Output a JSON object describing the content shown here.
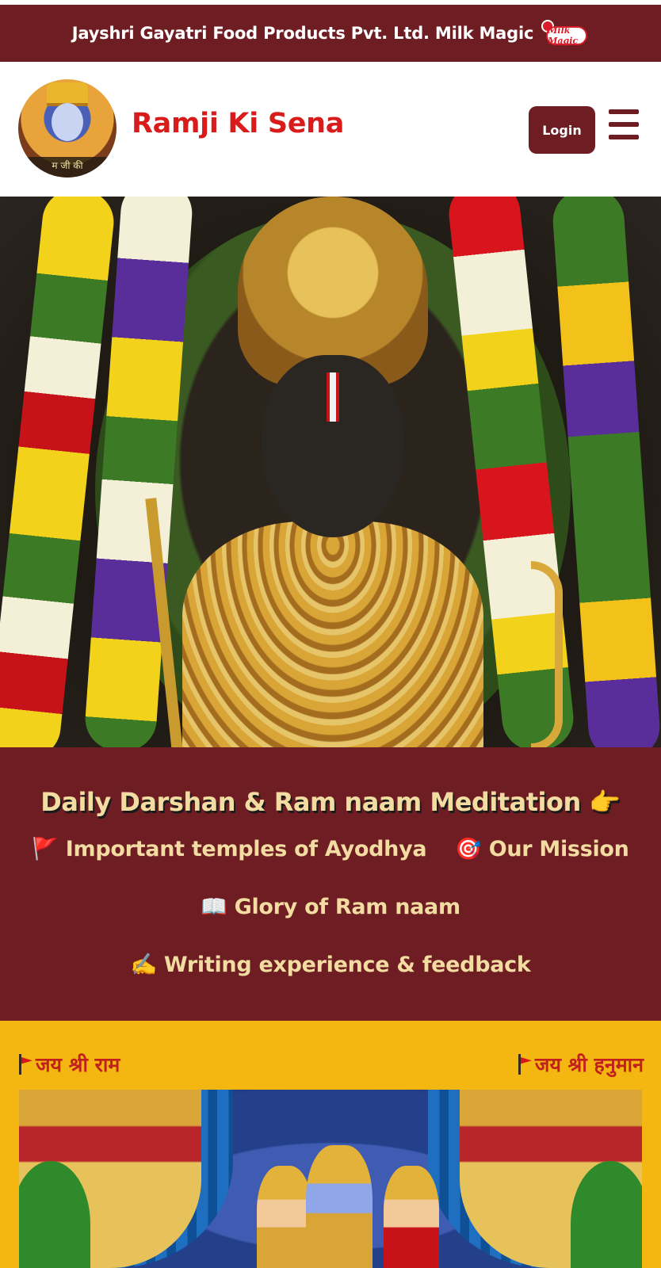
{
  "announcement": {
    "text": "Jayshri Gayatri Food Products Pvt. Ltd. Milk Magic",
    "brand_badge": "Milk Magic",
    "background_color": "#6e1e22"
  },
  "header": {
    "logo_caption": "म जी की",
    "site_title": "Ramji Ki Sena",
    "title_color": "#d81c1c",
    "login_label": "Login",
    "menu_icon": "hamburger-menu-icon"
  },
  "hero": {
    "image": "ram-lalla-idol-with-flower-garlands"
  },
  "links_panel": {
    "meditation": "Daily Darshan & Ram naam Meditation 👉",
    "links": [
      "🚩 Important temples of Ayodhya",
      "🎯 Our Mission",
      "📖 Glory of Ram naam",
      "✍️ Writing experience & feedback"
    ],
    "text_color": "#f2dca2"
  },
  "banner": {
    "chant_left": "जय श्री राम",
    "chant_right": "जय श्री हनुमान",
    "background_color": "#f4b711",
    "image": "ram-darbar-illustration"
  }
}
